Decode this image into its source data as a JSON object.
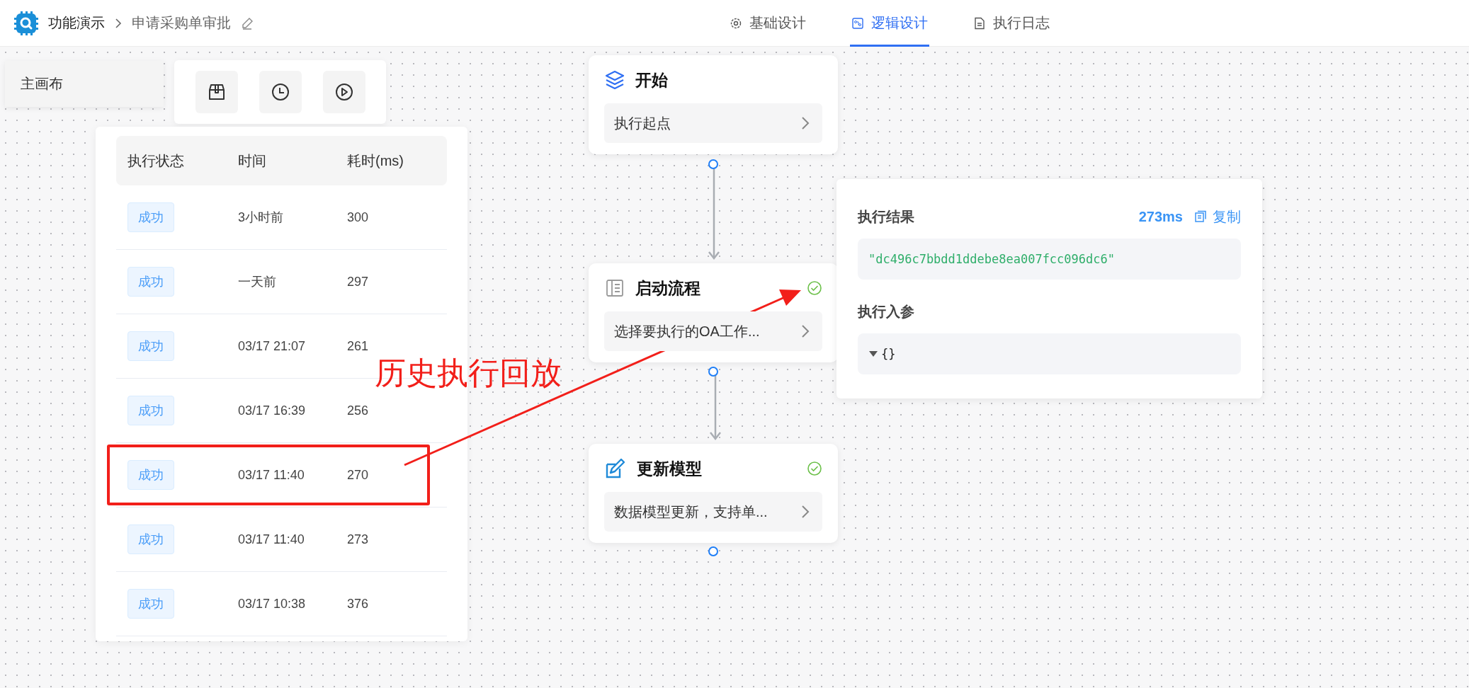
{
  "header": {
    "breadcrumb": [
      "功能演示",
      "申请采购单审批"
    ],
    "tabs": [
      {
        "label": "基础设计",
        "kind": "gear",
        "selected": false
      },
      {
        "label": "逻辑设计",
        "kind": "flow",
        "selected": true
      },
      {
        "label": "执行日志",
        "kind": "doc",
        "selected": false
      }
    ]
  },
  "canvas_tab": "主画布",
  "history": {
    "columns": [
      "执行状态",
      "时间",
      "耗时(ms)"
    ],
    "rows": [
      {
        "status": "成功",
        "time": "3小时前",
        "duration": "300",
        "annotated": false
      },
      {
        "status": "成功",
        "time": "一天前",
        "duration": "297",
        "annotated": false
      },
      {
        "status": "成功",
        "time": "03/17 21:07",
        "duration": "261",
        "annotated": false
      },
      {
        "status": "成功",
        "time": "03/17 16:39",
        "duration": "256",
        "annotated": false
      },
      {
        "status": "成功",
        "time": "03/17 11:40",
        "duration": "270",
        "annotated": true
      },
      {
        "status": "成功",
        "time": "03/17 11:40",
        "duration": "273",
        "annotated": false
      },
      {
        "status": "成功",
        "time": "03/17 10:38",
        "duration": "376",
        "annotated": false
      }
    ]
  },
  "annotation": {
    "text": "历史执行回放"
  },
  "nodes": [
    {
      "kind": "start",
      "title": "开始",
      "description": "执行起点",
      "done": false
    },
    {
      "kind": "process",
      "title": "启动流程",
      "description": "选择要执行的OA工作...",
      "done": true
    },
    {
      "kind": "update",
      "title": "更新模型",
      "description": "数据模型更新，支持单...",
      "done": true
    }
  ],
  "result": {
    "title": "执行结果",
    "duration": "273ms",
    "copy": "复制",
    "value": "\"dc496c7bbdd1ddebe8ea007fcc096dc6\"",
    "params_title": "执行入参",
    "params": "{}"
  }
}
